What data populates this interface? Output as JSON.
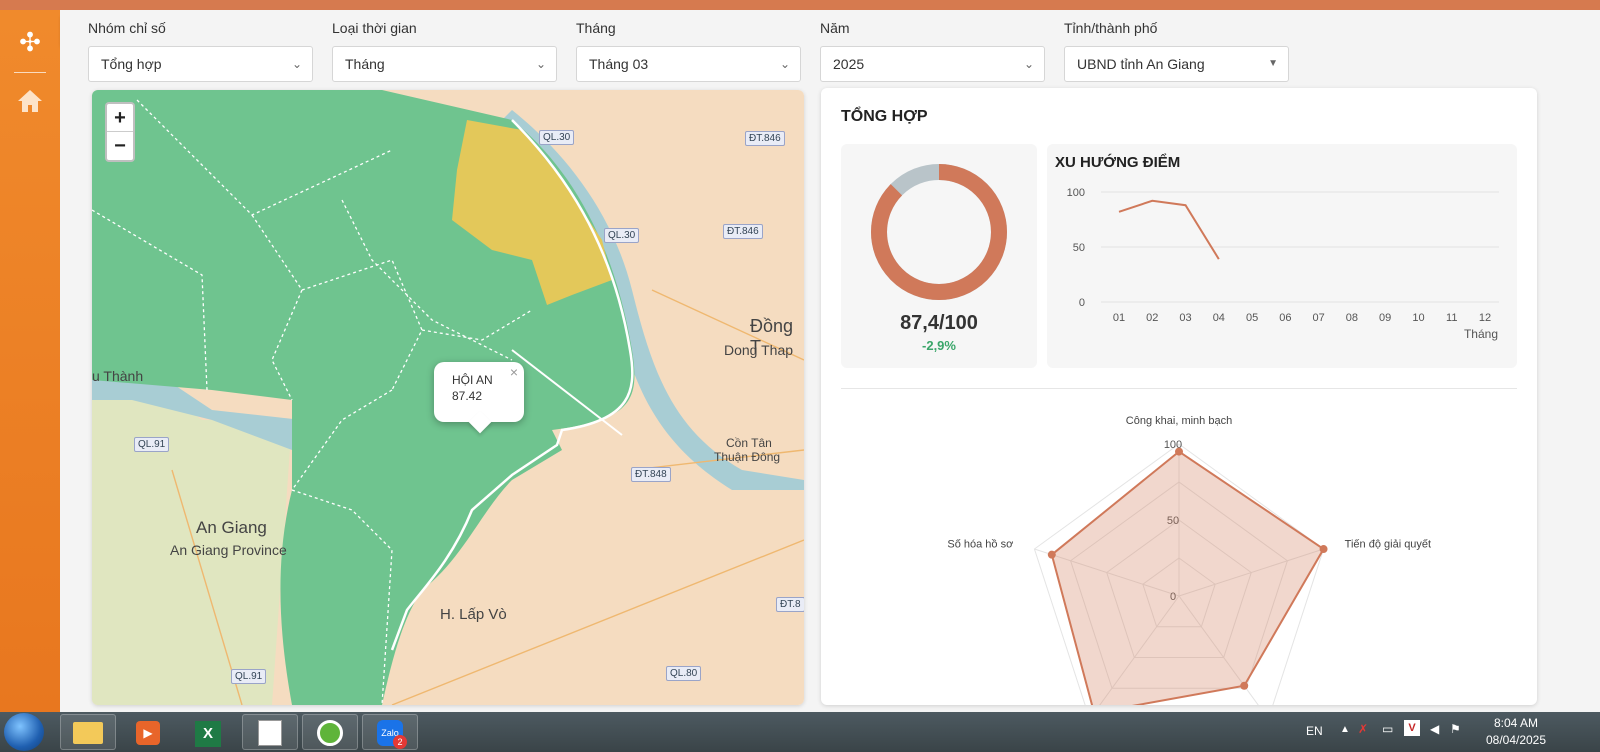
{
  "filters": [
    {
      "label": "Nhóm chỉ số",
      "value": "Tổng hợp"
    },
    {
      "label": "Loại thời gian",
      "value": "Tháng"
    },
    {
      "label": "Tháng",
      "value": "Tháng 03"
    },
    {
      "label": "Năm",
      "value": "2025"
    },
    {
      "label": "Tỉnh/thành phố",
      "value": "UBND tỉnh An Giang"
    }
  ],
  "map": {
    "zoom_in": "+",
    "zoom_out": "−",
    "popup": {
      "name": "HỘI AN",
      "value": "87.42",
      "close": "×"
    },
    "place_labels": [
      "Đồng T",
      "Dong Thap",
      "An Giang",
      "An Giang Province",
      "H. Lấp Vò",
      "Cồn Tân",
      "Thuận Đông",
      "u Thành"
    ],
    "road_labels": [
      "QL.30",
      "ĐT.846",
      "QL.30",
      "ĐT.846",
      "QL.91",
      "ĐT.848",
      "QL.91",
      "QL.80",
      "ĐT.8"
    ]
  },
  "summary": {
    "title": "TỔNG HỢP",
    "score": "87,4/100",
    "delta": "-2,9%",
    "donut": {
      "value": 87.4,
      "max": 100,
      "color": "#d0795a",
      "rest_color": "#b9c4c9"
    }
  },
  "chart_data": [
    {
      "type": "line",
      "title": "XU HƯỚNG ĐIỂM",
      "xlabel": "Tháng",
      "ylabel": "",
      "categories": [
        "01",
        "02",
        "03",
        "04",
        "05",
        "06",
        "07",
        "08",
        "09",
        "10",
        "11",
        "12"
      ],
      "series": [
        {
          "values": [
            82,
            92,
            88,
            39,
            null,
            null,
            null,
            null,
            null,
            null,
            null,
            null
          ]
        }
      ],
      "ylim": [
        0,
        100
      ],
      "yticks": [
        0,
        50,
        100
      ],
      "grid": true,
      "color": "#d0795a"
    },
    {
      "type": "radar",
      "axes": [
        "Công khai, minh bạch",
        "Tiến độ giải quyết",
        "",
        "",
        "Số hóa hồ sơ"
      ],
      "values": [
        95,
        100,
        73,
        95,
        88
      ],
      "rlim": [
        0,
        100
      ],
      "rticks": [
        0,
        50,
        100
      ],
      "color": "#d0795a"
    }
  ],
  "taskbar": {
    "apps": [
      "file-explorer-icon",
      "media-player-icon",
      "excel-icon",
      "sticky-notes-icon",
      "coccoc-browser-icon",
      "zalo-icon"
    ],
    "zalo_badge": "2",
    "lang": "EN",
    "time": "8:04 AM",
    "date": "08/04/2025"
  }
}
